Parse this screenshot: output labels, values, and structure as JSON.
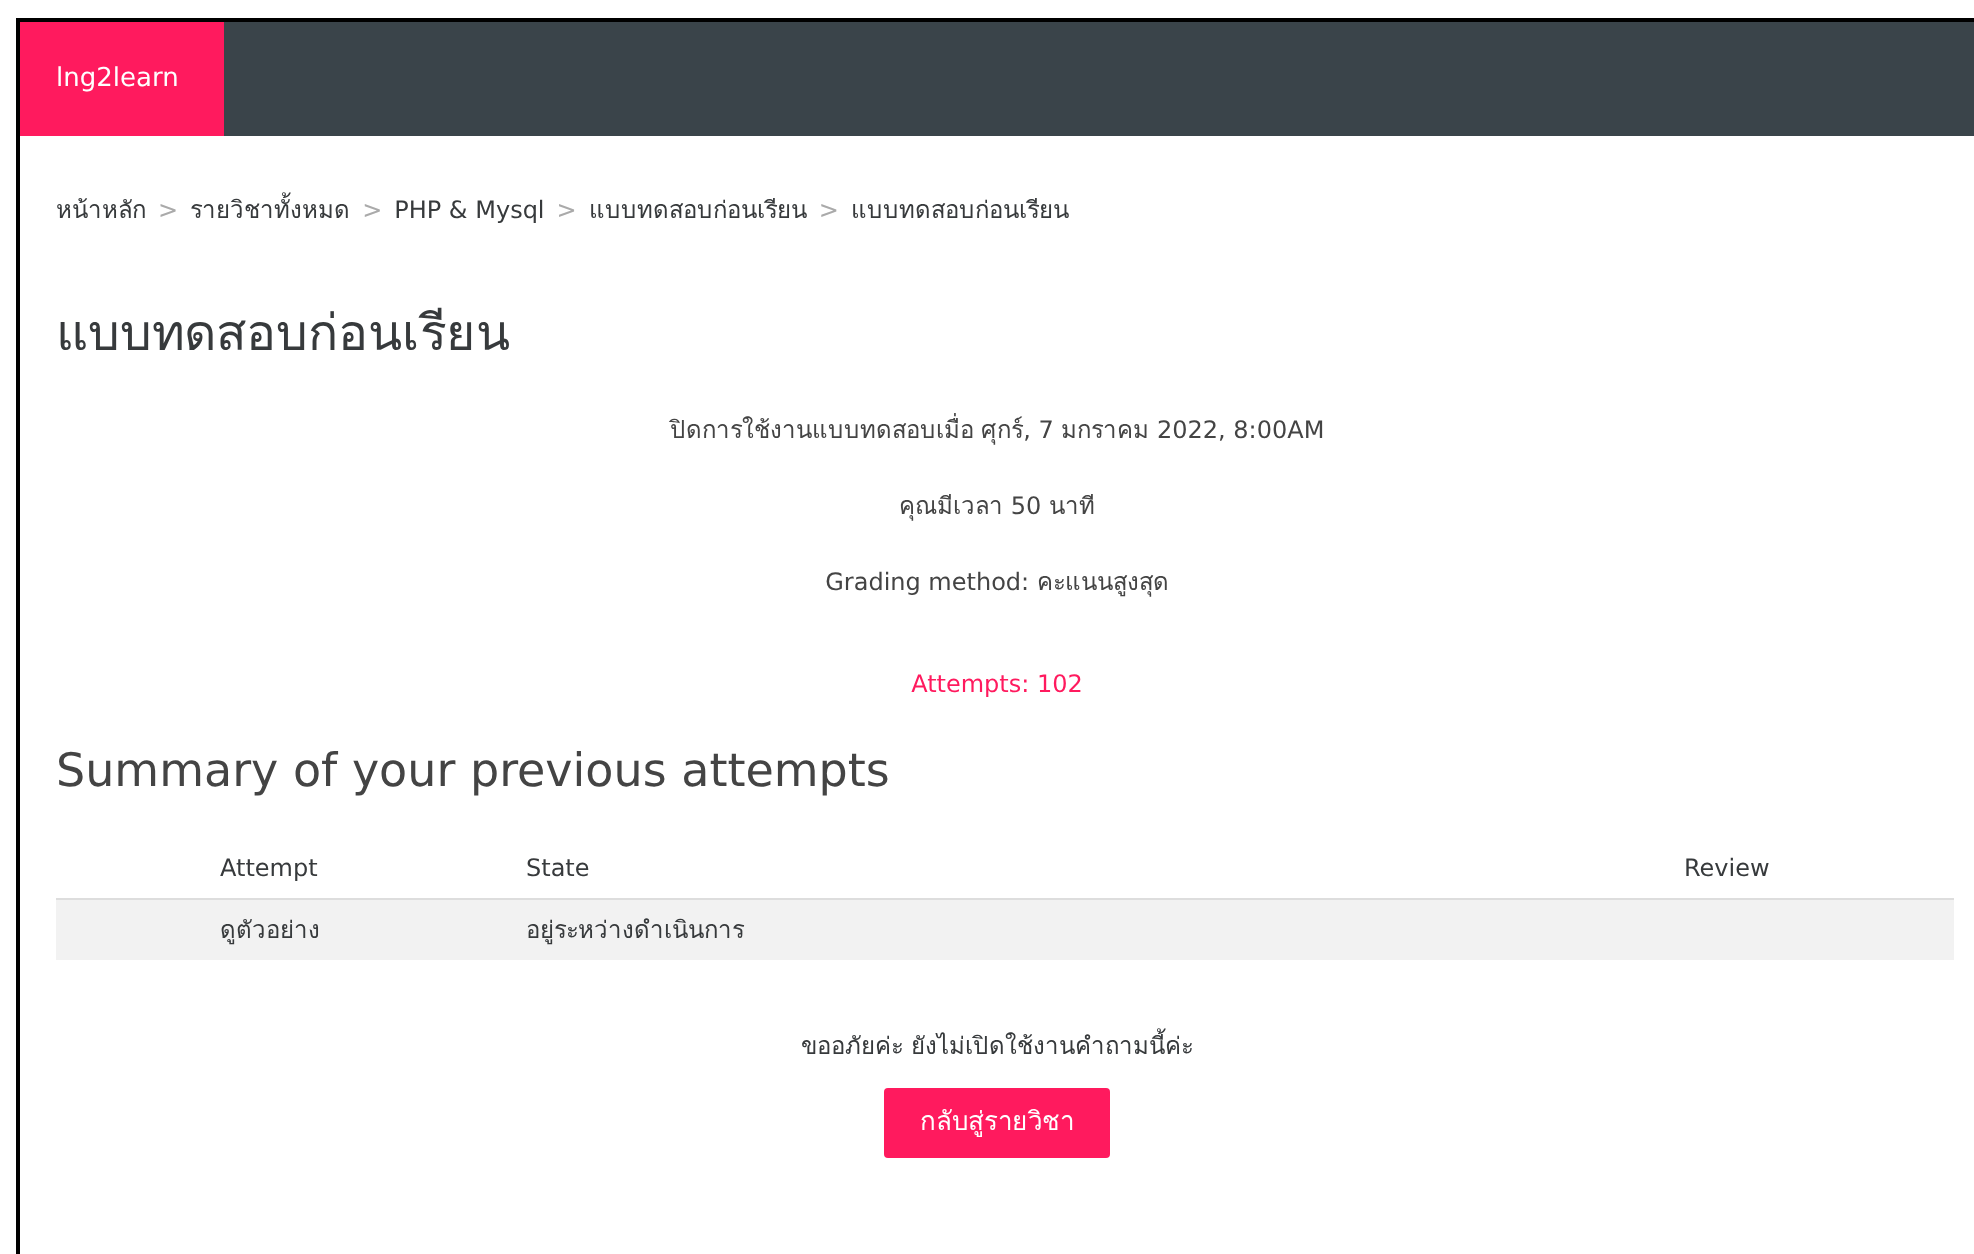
{
  "navbar": {
    "brand": "lng2learn"
  },
  "breadcrumb": [
    {
      "label": "หน้าหลัก"
    },
    {
      "label": "รายวิชาทั้งหมด"
    },
    {
      "label": "PHP & Mysql"
    },
    {
      "label": "แบบทดสอบก่อนเรียน"
    },
    {
      "label": "แบบทดสอบก่อนเรียน"
    }
  ],
  "breadcrumb_separator": ">",
  "title": "แบบทดสอบก่อนเรียน",
  "info": [
    "ปิดการใช้งานแบบทดสอบเมื่อ ศุกร์, 7 มกราคม 2022, 8:00AM",
    "คุณมีเวลา 50 นาที",
    "Grading method: คะแนนสูงสุด"
  ],
  "attempts_link": "Attempts: 102",
  "summary": {
    "heading": "Summary of your previous attempts",
    "columns": [
      "Attempt",
      "State",
      "Review"
    ],
    "rows": [
      [
        "ดูตัวอย่าง",
        "อยู่ระหว่างดำเนินการ",
        ""
      ]
    ]
  },
  "message": "ขออภัยค่ะ ยังไม่เปิดใช้งานคำถามนี้ค่ะ",
  "back_button": "กลับสู่รายวิชา"
}
